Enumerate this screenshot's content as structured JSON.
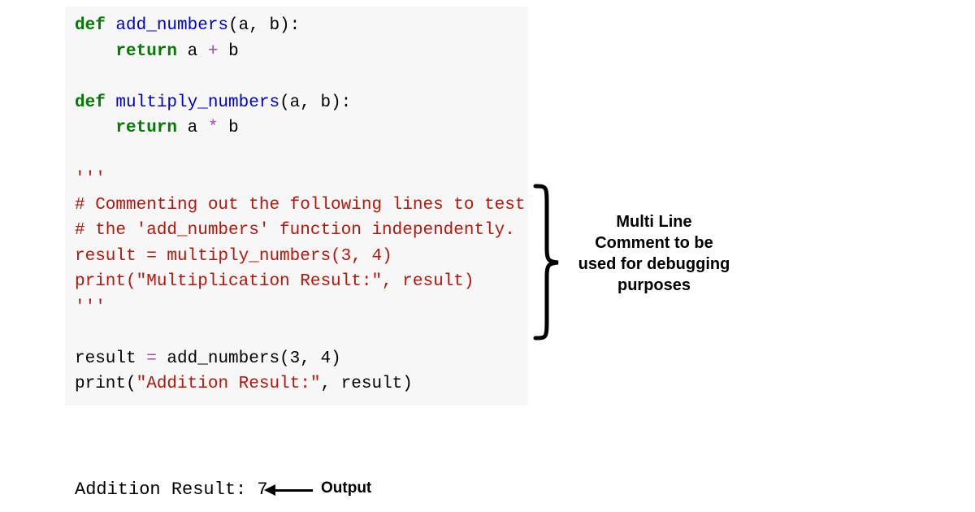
{
  "code": {
    "l1_def": "def",
    "l1_fn": " add_numbers",
    "l1_rest": "(a, b):",
    "l2_indent": "    ",
    "l2_ret": "return",
    "l2_expr_a": " a ",
    "l2_op": "+",
    "l2_expr_b": " b",
    "l4_def": "def",
    "l4_fn": " multiply_numbers",
    "l4_rest": "(a, b):",
    "l5_indent": "    ",
    "l5_ret": "return",
    "l5_expr_a": " a ",
    "l5_op": "*",
    "l5_expr_b": " b",
    "l7_triple": "'''",
    "l8_c": "# Commenting out the following lines to test",
    "l9_c": "# the 'add_numbers' function independently.",
    "l10_c": "result = multiply_numbers(3, 4)",
    "l11_c": "print(\"Multiplication Result:\", result)",
    "l12_triple": "'''",
    "l14_a": "result ",
    "l14_eq": "=",
    "l14_b": " add_numbers(",
    "l14_n1": "3",
    "l14_c": ", ",
    "l14_n2": "4",
    "l14_d": ")",
    "l15_a": "print(",
    "l15_s": "\"Addition Result:\"",
    "l15_b": ", result)"
  },
  "output": "Addition Result: 7",
  "annotation": "Multi Line Comment to be used for debugging purposes",
  "output_label": "Output"
}
